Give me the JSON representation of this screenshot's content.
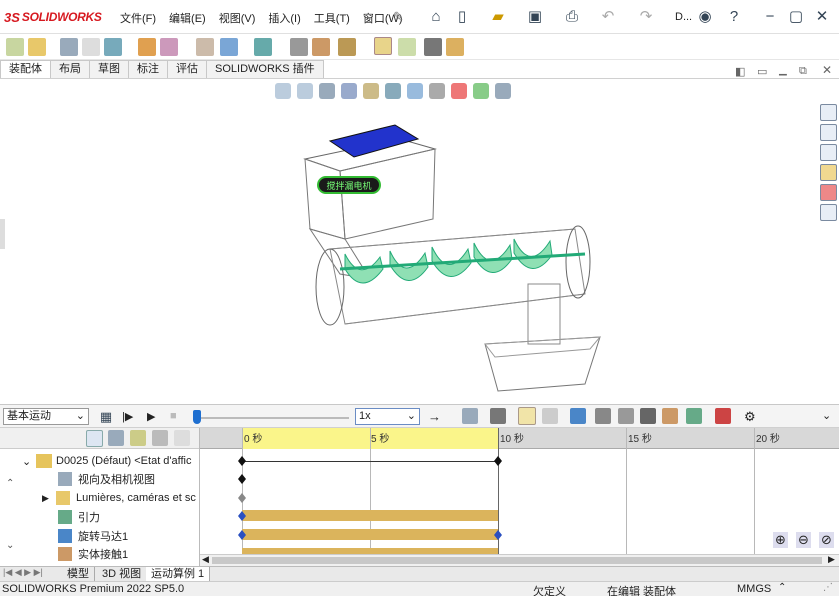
{
  "app": {
    "brand_ds": "3S",
    "brand_name": "SOLIDWORKS"
  },
  "menu": [
    "文件(F)",
    "编辑(E)",
    "视图(V)",
    "插入(I)",
    "工具(T)",
    "窗口(W)"
  ],
  "title_truncated": "D...",
  "tabs": [
    "装配体",
    "布局",
    "草图",
    "标注",
    "评估",
    "SOLIDWORKS 插件"
  ],
  "model_label": "搅拌漏电机",
  "motion": {
    "study_type": "基本运动",
    "speed": "1x"
  },
  "timeline": {
    "tick_labels": [
      "0 秒",
      "5 秒",
      "10 秒",
      "15 秒",
      "20 秒"
    ]
  },
  "tree": {
    "root": "D0025 (Défaut) <Etat d'affic",
    "items": [
      "视向及相机视图",
      "Lumières, caméras et sc",
      "引力",
      "旋转马达1",
      "实体接触1"
    ]
  },
  "bottom_tabs": [
    "模型",
    "3D 视图",
    "运动算例 1"
  ],
  "status": {
    "product": "SOLIDWORKS Premium 2022 SP5.0",
    "custom": "欠定义",
    "editing": "在编辑 装配体",
    "units": "MMGS"
  },
  "colors": {
    "accent": "#1e6fd0",
    "bar": "#dbb45c",
    "yellow": "#faf58a",
    "screw": "#8fe0b4",
    "motor": "#2233cc"
  }
}
